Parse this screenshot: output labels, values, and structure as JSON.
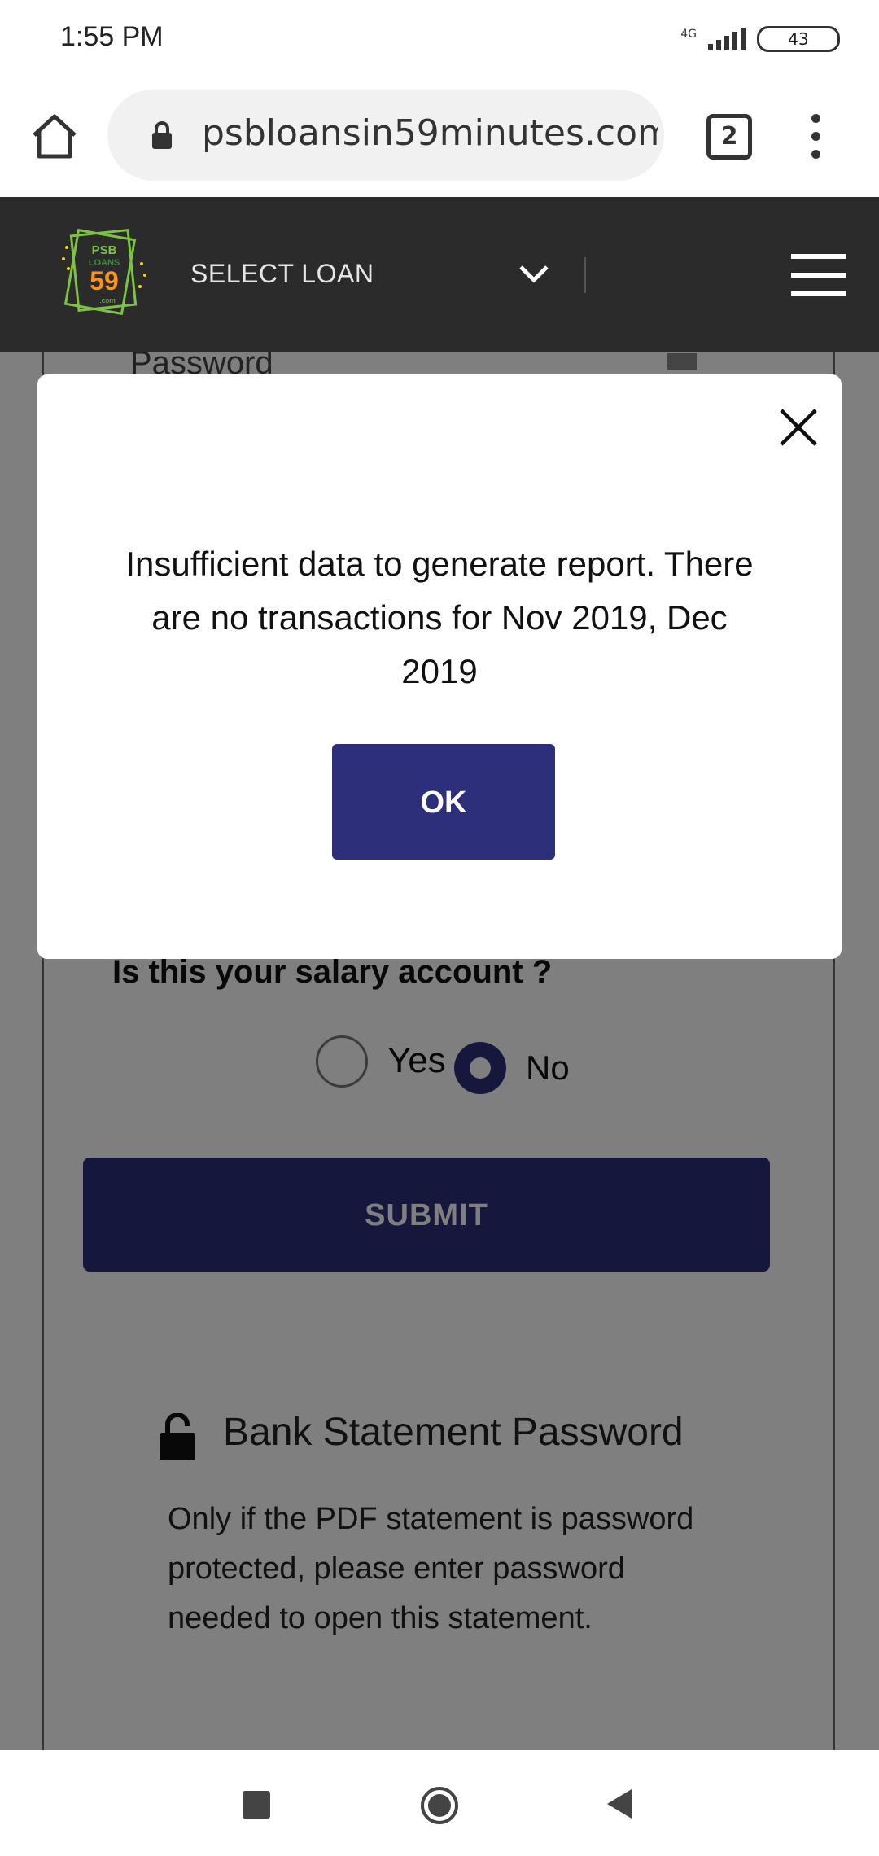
{
  "status_bar": {
    "time": "1:55 PM",
    "network": "4G",
    "battery": "43"
  },
  "browser": {
    "url": "psbloansin59minutes.com/",
    "tab_count": "2"
  },
  "site_header": {
    "logo_text_top": "PSB",
    "logo_text_mid": "LOANS",
    "logo_number": "59",
    "logo_text_bottom": ".com",
    "select_loan": "SELECT LOAN"
  },
  "page": {
    "password_label": "Password",
    "salary_question": "Is this your salary account ?",
    "radio_yes_label": "Yes",
    "radio_no_label": "No",
    "selected_option": "No",
    "submit_label": "SUBMIT",
    "bank_statement_title": "Bank Statement Password",
    "bank_statement_desc": "Only if the PDF statement is password protected, please enter password needed to open this statement."
  },
  "modal": {
    "message": "Insufficient data to generate report. There are no transactions for Nov 2019, Dec 2019",
    "ok_label": "OK"
  },
  "colors": {
    "accent": "#2d2f7a",
    "header_bg": "#2b2b2b",
    "logo_green": "#7cc243",
    "logo_orange": "#f7941d"
  }
}
